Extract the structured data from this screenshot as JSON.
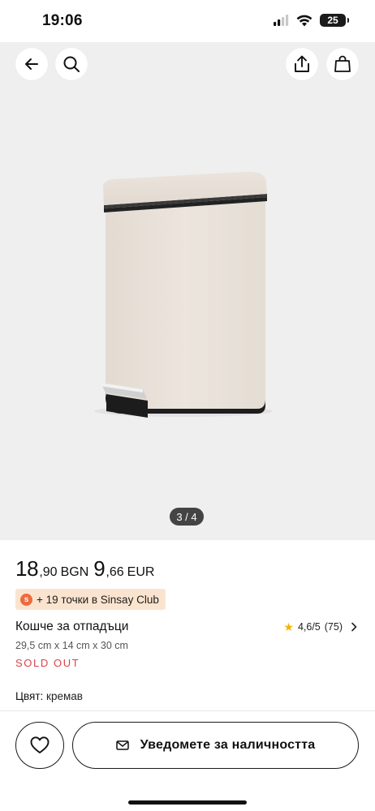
{
  "status_bar": {
    "time": "19:06",
    "battery_level": "25",
    "icons": [
      "signal-icon",
      "wifi-icon",
      "battery-icon"
    ]
  },
  "gallery": {
    "counter": "3 / 4",
    "background_color": "#efefef",
    "product_color": "#e9e1d8"
  },
  "toolbar": {
    "back_icon": "arrow-left-icon",
    "search_icon": "search-icon",
    "share_icon": "share-icon",
    "bag_icon": "shopping-bag-icon"
  },
  "price": {
    "bgn_main": "18",
    "bgn_frac": ",90",
    "bgn_currency": "BGN",
    "eur_main": "9",
    "eur_frac": ",66",
    "eur_currency": "EUR"
  },
  "points": {
    "icon_char": "s",
    "text": "+ 19 точки в Sinsay Club",
    "badge_color": "#fbe4cf"
  },
  "product": {
    "title": "Кошче за отпадъци",
    "dimensions": "29,5 cm x 14 cm x 30 cm",
    "status": "SOLD OUT",
    "status_color": "#d9434b"
  },
  "rating": {
    "value": "4,6/5",
    "count": "(75)"
  },
  "color": {
    "label": "Цвят:",
    "value": "кремав"
  },
  "actions": {
    "favorite_icon": "heart-icon",
    "notify_icon": "mail-icon",
    "notify_label": "Уведомете за наличността"
  }
}
